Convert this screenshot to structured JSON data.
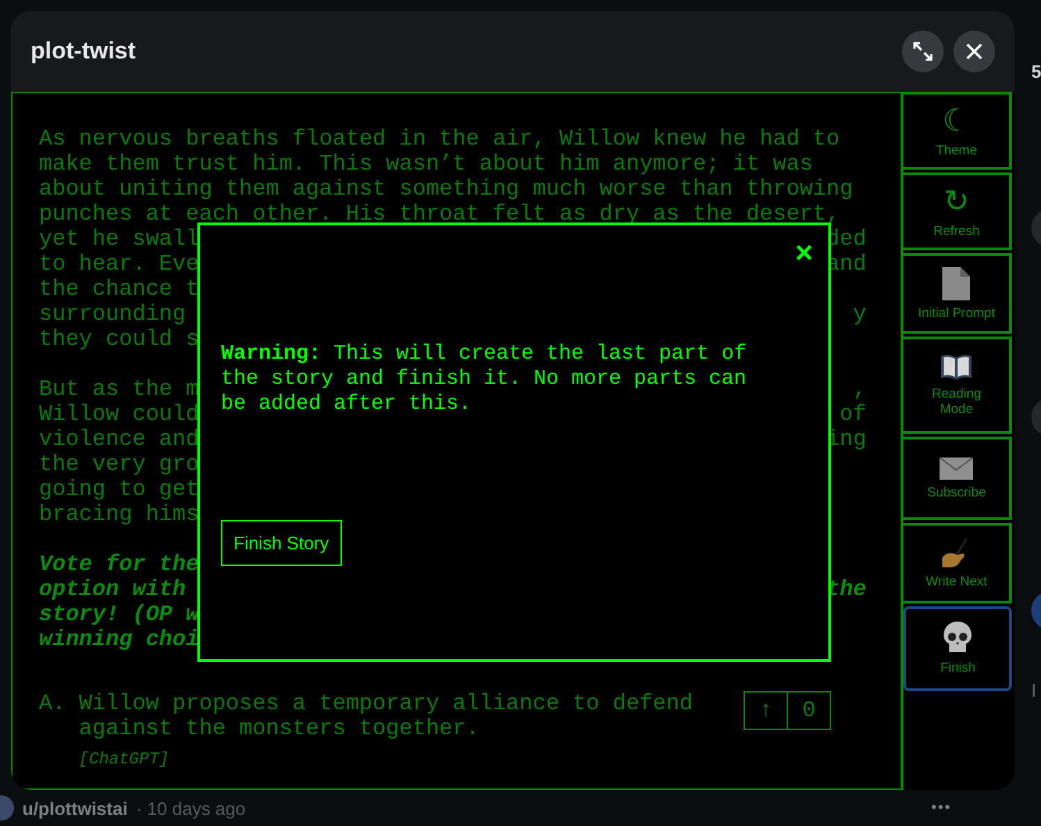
{
  "window": {
    "title": "plot-twist"
  },
  "header_buttons": [
    {
      "kind": "expand"
    },
    {
      "kind": "close"
    }
  ],
  "story": {
    "paragraphs": [
      {
        "kind": "plain",
        "lines": [
          {
            "left": "As nervous breaths floated in the air, Willow knew he had to"
          },
          {
            "left": "make them trust him. This wasn’t about him anymore; it was"
          },
          {
            "left": "about uniting them against something much worse than throwing"
          },
          {
            "left": "punches at each other. His throat felt as dry as the desert,"
          },
          {
            "left": "yet he swall",
            "right": "ded"
          },
          {
            "left": "to hear. Eve",
            "right": "and"
          },
          {
            "left": "the chance t"
          },
          {
            "left": "surrounding",
            "right": "y"
          },
          {
            "left": "they could s"
          }
        ]
      },
      {
        "kind": "plain",
        "lines": [
          {
            "left": "But as the m",
            "right": ","
          },
          {
            "left": "Willow could",
            "right": "of"
          },
          {
            "left": "violence and",
            "right": "ing"
          },
          {
            "left": "the very gro"
          },
          {
            "left": "going to get"
          },
          {
            "left": "bracing hims"
          }
        ]
      },
      {
        "kind": "vote-call",
        "lines": [
          {
            "left": "Vote for the"
          },
          {
            "left": "option with",
            "right": "the"
          },
          {
            "left": "story! (OP w"
          },
          {
            "left": "winning choi"
          }
        ]
      }
    ],
    "options": [
      {
        "label": "A.",
        "text": "Willow proposes a temporary alliance to defend against the monsters together.",
        "source": "[ChatGPT]",
        "vote_arrow": "↑",
        "votes": "0"
      }
    ]
  },
  "dialog": {
    "close": "×",
    "message": "**Warning:** This will create the last part of the story and finish it. No more parts can be added after this.",
    "button": "Finish Story"
  },
  "sidebar": [
    {
      "label": "Theme",
      "kind": "glyph",
      "icon": "☾",
      "selected": false
    },
    {
      "label": "Refresh",
      "kind": "glyph",
      "icon": "↻",
      "selected": false
    },
    {
      "label": "Initial Prompt",
      "kind": "page",
      "selected": false
    },
    {
      "label": "Reading Mode",
      "kind": "book",
      "selected": false
    },
    {
      "label": "Subscribe",
      "kind": "envelope",
      "selected": false
    },
    {
      "label": "Write Next",
      "kind": "writing-hand",
      "selected": false
    },
    {
      "label": "Finish",
      "kind": "skull",
      "selected": true
    }
  ],
  "post_footer": {
    "author": "u/plottwistai",
    "time": "· 10 days ago",
    "more": "•••"
  },
  "right_rail": [
    {
      "kind": "count",
      "text": "5"
    },
    {
      "kind": "avatar"
    },
    {
      "kind": "avatar"
    },
    {
      "kind": "avatar-blue"
    },
    {
      "kind": "text",
      "text": "I"
    }
  ]
}
